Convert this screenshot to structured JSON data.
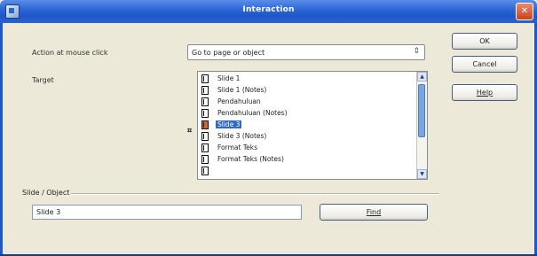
{
  "window": {
    "title": "Interaction"
  },
  "action": {
    "label": "Action at mouse click",
    "selected": "Go to page or object"
  },
  "target": {
    "label": "Target",
    "items": [
      {
        "label": "Slide 1",
        "selected": false
      },
      {
        "label": "Slide 1 (Notes)",
        "selected": false
      },
      {
        "label": "Pendahuluan",
        "selected": false
      },
      {
        "label": "Pendahuluan (Notes)",
        "selected": false
      },
      {
        "label": "Slide 3",
        "selected": true
      },
      {
        "label": "Slide 3 (Notes)",
        "selected": false
      },
      {
        "label": "Format Teks",
        "selected": false
      },
      {
        "label": "Format Teks (Notes)",
        "selected": false
      }
    ]
  },
  "slide_object": {
    "label": "Slide / Object",
    "value": "Slide 3",
    "find_label": "Find"
  },
  "buttons": {
    "ok": "OK",
    "cancel": "Cancel",
    "help": "Help"
  },
  "colors": {
    "titlebar": "#2a63d6",
    "selection": "#316ac5",
    "dialog_bg": "#ece9d8"
  }
}
